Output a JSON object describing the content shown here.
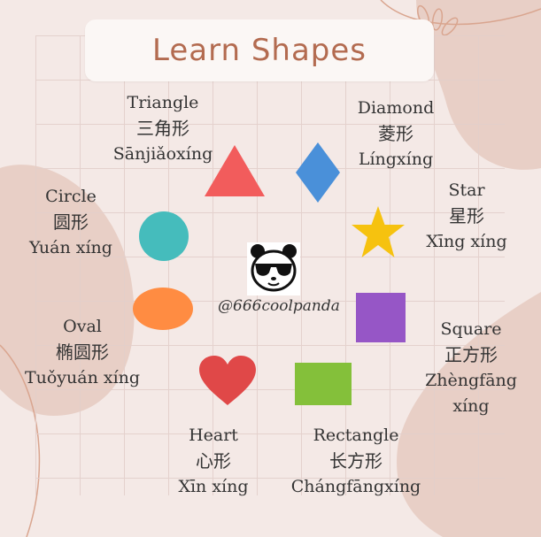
{
  "title": "Learn Shapes",
  "handle": "@666coolpanda",
  "colors": {
    "background": "#f4e9e6",
    "blob": "#e8cfc6",
    "title_text": "#b36b50",
    "triangle": "#f25c5c",
    "diamond": "#4a90d9",
    "circle": "#45bcbc",
    "star": "#f6c20f",
    "oval": "#ff8c42",
    "square": "#9656c6",
    "heart": "#e04848",
    "rectangle": "#84c03a"
  },
  "shapes": {
    "triangle": {
      "en": "Triangle",
      "zh": "三角形",
      "pinyin": "Sānjiǎoxíng"
    },
    "diamond": {
      "en": "Diamond",
      "zh": "菱形",
      "pinyin": "Língxíng"
    },
    "circle": {
      "en": "Circle",
      "zh": "圆形",
      "pinyin": "Yuán xíng"
    },
    "star": {
      "en": "Star",
      "zh": "星形",
      "pinyin": "Xīng xíng"
    },
    "oval": {
      "en": "Oval",
      "zh": "椭圆形",
      "pinyin": "Tuǒyuán xíng"
    },
    "square": {
      "en": "Square",
      "zh": "正方形",
      "pinyin_line1": "Zhèngfāng",
      "pinyin_line2": "xíng"
    },
    "heart": {
      "en": "Heart",
      "zh": "心形",
      "pinyin": "Xīn xíng"
    },
    "rectangle": {
      "en": "Rectangle",
      "zh": "长方形",
      "pinyin": "Chángfāngxíng"
    }
  }
}
